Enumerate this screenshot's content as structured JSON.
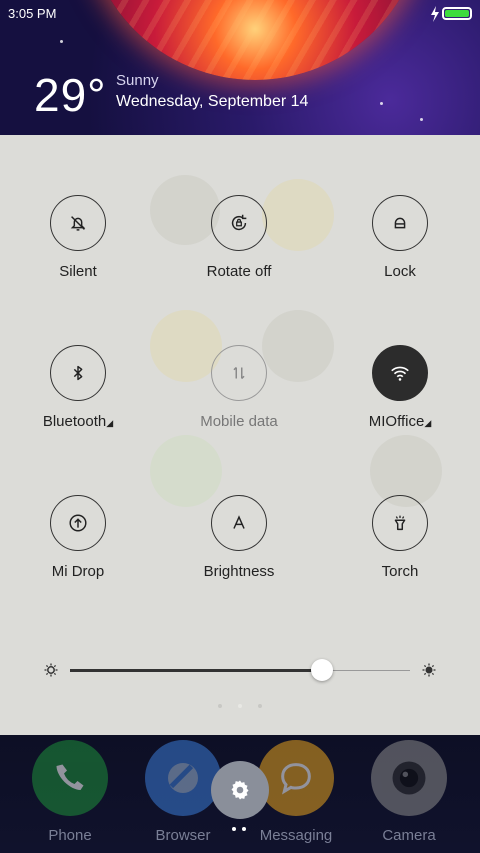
{
  "status_bar": {
    "time": "3:05 PM",
    "charging": true,
    "battery_color": "#3ddc3d"
  },
  "weather": {
    "temperature": "29°",
    "condition": "Sunny",
    "date": "Wednesday, September 14"
  },
  "tiles": [
    {
      "label": "Silent",
      "icon": "bell-off-icon",
      "state": "off"
    },
    {
      "label": "Rotate off",
      "icon": "rotate-lock-icon",
      "state": "off"
    },
    {
      "label": "Lock",
      "icon": "lock-icon",
      "state": "off"
    },
    {
      "label": "Bluetooth",
      "icon": "bluetooth-icon",
      "state": "off",
      "has_menu": true
    },
    {
      "label": "Mobile data",
      "icon": "mobile-data-icon",
      "state": "disabled"
    },
    {
      "label": "MIOffice",
      "icon": "wifi-icon",
      "state": "on",
      "has_menu": true
    },
    {
      "label": "Mi Drop",
      "icon": "upload-icon",
      "state": "off"
    },
    {
      "label": "Brightness",
      "icon": "auto-brightness-icon",
      "state": "off"
    },
    {
      "label": "Torch",
      "icon": "torch-icon",
      "state": "off"
    }
  ],
  "brightness": {
    "level_percent": 74
  },
  "dock": {
    "apps": [
      {
        "label": "Phone",
        "icon": "phone-icon",
        "color": "#1e8f3a"
      },
      {
        "label": "Browser",
        "icon": "browser-icon",
        "color": "#3a7bd5"
      },
      {
        "label": "Messaging",
        "icon": "message-icon",
        "color": "#e6a21e"
      },
      {
        "label": "Camera",
        "icon": "camera-icon",
        "color": "#8a8a8a"
      }
    ],
    "settings_icon": "gear-icon"
  },
  "colors": {
    "panel_bg": "#dcdcd8",
    "active_tile": "#2c2c2c",
    "header_bg": "#2a1a6a"
  }
}
